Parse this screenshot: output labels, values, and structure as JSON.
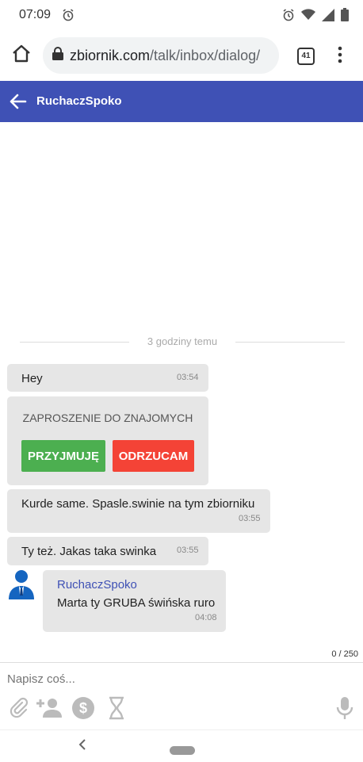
{
  "statusbar": {
    "time": "07:09"
  },
  "browser": {
    "domain": "zbiornik.com",
    "path": "/talk/inbox/dialog/",
    "tab_count": "41"
  },
  "appbar": {
    "title": "RuchaczSpoko",
    "color": "#3f51b5"
  },
  "chat": {
    "divider": "3 godziny temu",
    "messages": [
      {
        "text": "Hey",
        "time": "03:54"
      },
      {
        "invite_title": "ZAPROSZENIE DO ZNAJOMYCH",
        "accept": "PRZYJMUJĘ",
        "reject": "ODRZUCAM"
      },
      {
        "text": "Kurde same. Spasle.swinie na tym zbiorniku",
        "time": "03:55"
      },
      {
        "text": "Ty też. Jakas taka swinka",
        "time": "03:55"
      },
      {
        "sender": "RuchaczSpoko",
        "text": "Marta ty GRUBA świńska ruro",
        "time": "04:08"
      }
    ],
    "accept_color": "#4caf50",
    "reject_color": "#f44336"
  },
  "composer": {
    "counter": "0 / 250",
    "placeholder": "Napisz coś..."
  }
}
